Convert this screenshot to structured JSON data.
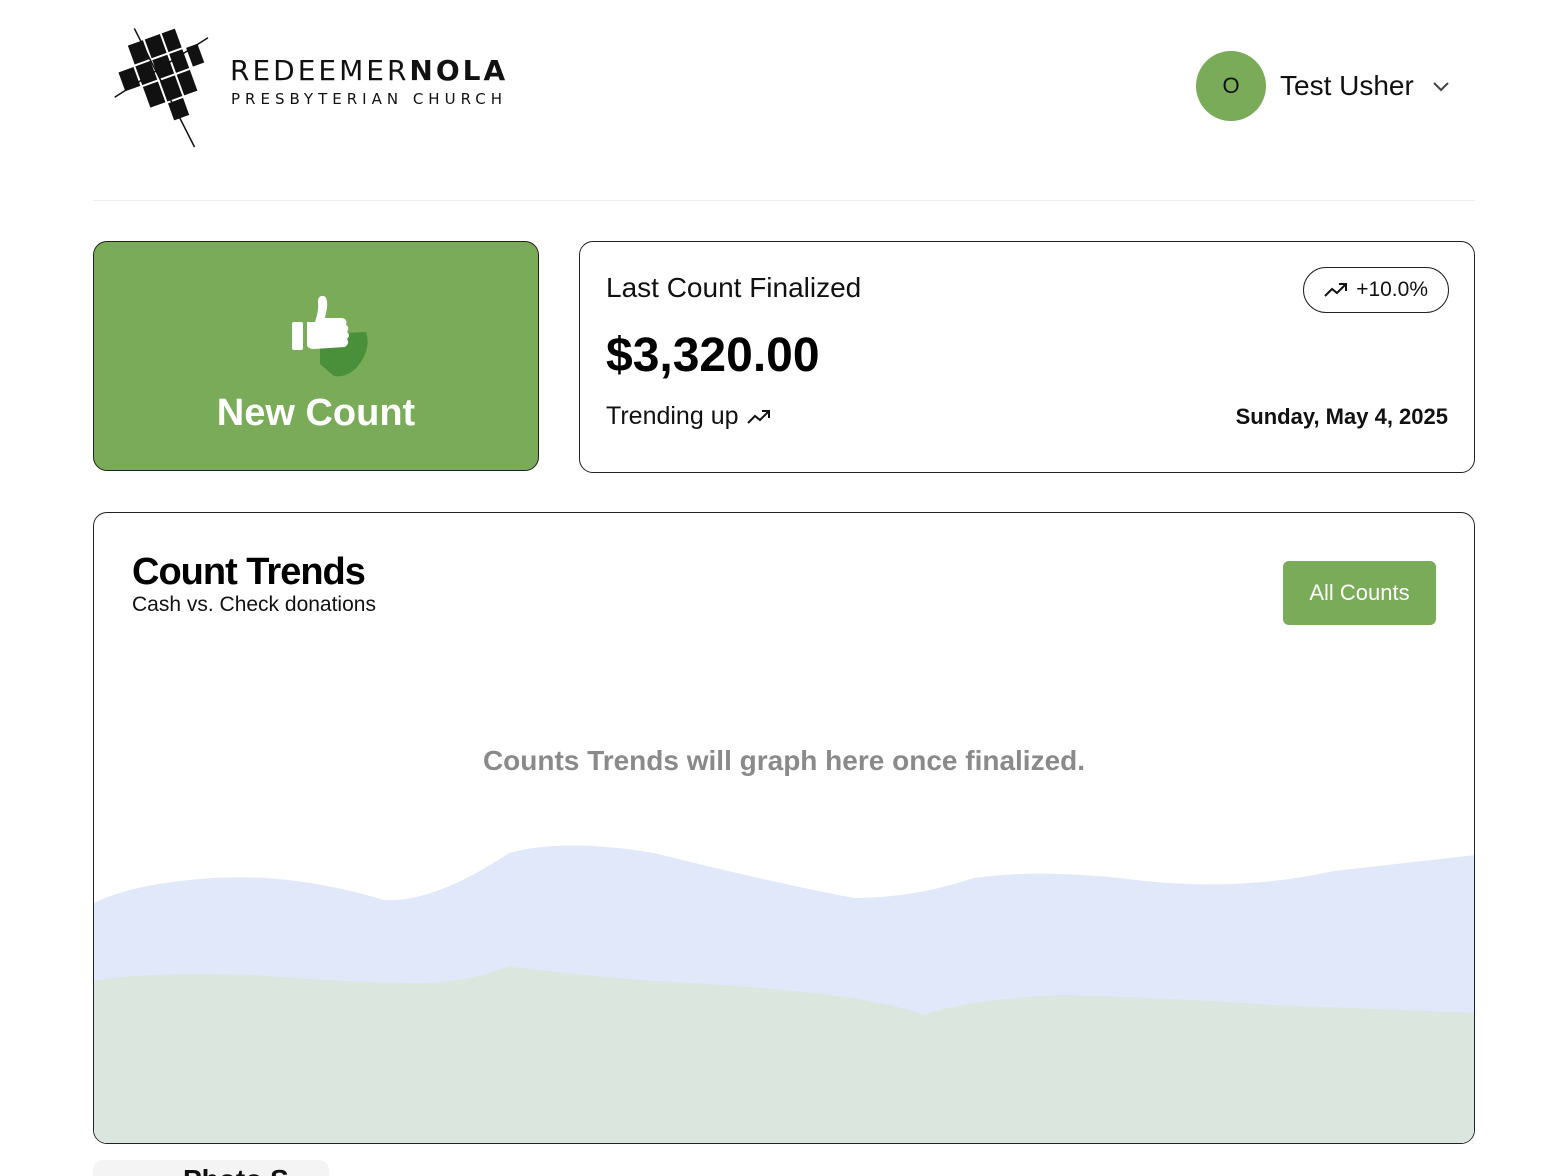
{
  "header": {
    "logo": {
      "name_light": "REDEEMER",
      "name_bold": "NOLA",
      "subtitle": "PRESBYTERIAN CHURCH"
    },
    "user": {
      "initial": "O",
      "name": "Test Usher",
      "menu_icon": "chevron-down-icon"
    }
  },
  "new_count": {
    "label": "New Count",
    "icon": "thumbs-up-icon"
  },
  "last_count": {
    "title": "Last Count Finalized",
    "amount": "$3,320.00",
    "badge": "+10.0%",
    "trend_text": "Trending up",
    "date": "Sunday, May 4, 2025",
    "trend_icon": "trending-up-icon"
  },
  "trends": {
    "title": "Count Trends",
    "subtitle": "Cash vs. Check donations",
    "button_label": "All Counts",
    "empty_message": "Counts Trends will graph here once finalized."
  },
  "next_card": {
    "title": "Photo S"
  },
  "colors": {
    "accent_green": "#7aab58",
    "wave_blue": "#e0e8f9",
    "wave_green": "#dbe6de",
    "muted_text": "#8a8a8a"
  }
}
